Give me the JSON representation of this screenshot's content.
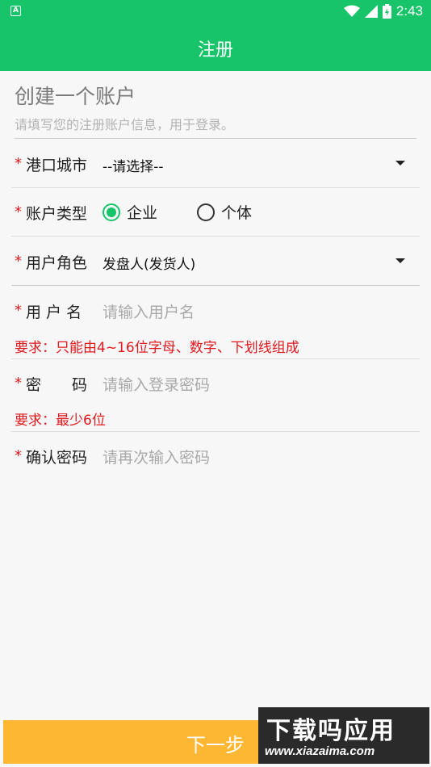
{
  "status_bar": {
    "time": "2:43"
  },
  "toolbar": {
    "title": "注册"
  },
  "header": {
    "title": "创建一个账户",
    "subtitle": "请填写您的注册账户信息，用于登录。"
  },
  "form": {
    "required_mark": "*",
    "city": {
      "label": "港口城市",
      "value": "--请选择--"
    },
    "account_type": {
      "label": "账户类型",
      "options": [
        "企业",
        "个体"
      ],
      "selected": "企业"
    },
    "role": {
      "label": "用户角色",
      "value": "发盘人(发货人)"
    },
    "username": {
      "label": "用 户 名",
      "placeholder": "请输入用户名",
      "hint": "要求：只能由4~16位字母、数字、下划线组成"
    },
    "password": {
      "label": "密　　码",
      "placeholder": "请输入登录密码",
      "hint": "要求：最少6位"
    },
    "confirm_password": {
      "label": "确认密码",
      "placeholder": "请再次输入密码"
    }
  },
  "next_button": {
    "label": "下一步"
  },
  "watermark": {
    "title": "下载吗应用",
    "url": "www.xiazaima.com"
  },
  "colors": {
    "primary": "#17c46a",
    "button": "#fdb733",
    "error": "#e0191f"
  },
  "icons": [
    "app-notification-icon",
    "wifi-icon",
    "signal-icon",
    "battery-icon",
    "dropdown-arrow-icon",
    "radio-icon"
  ]
}
